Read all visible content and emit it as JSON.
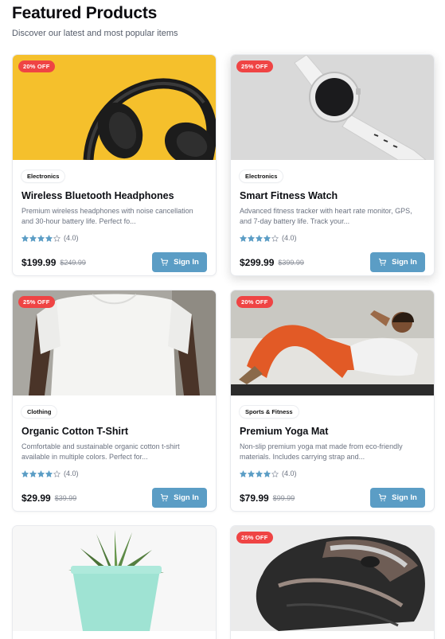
{
  "header": {
    "title": "Featured Products",
    "subtitle": "Discover our latest and most popular items"
  },
  "colors": {
    "accent": "#5b9dc5",
    "discount": "#ef4444",
    "star": "#5b9dc5"
  },
  "products": [
    {
      "discount": "20% OFF",
      "category": "Electronics",
      "name": "Wireless Bluetooth Headphones",
      "description": "Premium wireless headphones with noise cancellation and 30-hour battery life. Perfect fo...",
      "rating": 4.0,
      "rating_label": "(4.0)",
      "price": "$199.99",
      "old_price": "$249.99",
      "button_label": "Sign In",
      "image_icon": "headphones-image"
    },
    {
      "discount": "25% OFF",
      "category": "Electronics",
      "name": "Smart Fitness Watch",
      "description": "Advanced fitness tracker with heart rate monitor, GPS, and 7-day battery life. Track your...",
      "rating": 4.0,
      "rating_label": "(4.0)",
      "price": "$299.99",
      "old_price": "$399.99",
      "button_label": "Sign In",
      "image_icon": "smartwatch-image"
    },
    {
      "discount": "25% OFF",
      "category": "Clothing",
      "name": "Organic Cotton T-Shirt",
      "description": "Comfortable and sustainable organic cotton t-shirt available in multiple colors. Perfect for...",
      "rating": 4.0,
      "rating_label": "(4.0)",
      "price": "$29.99",
      "old_price": "$39.99",
      "button_label": "Sign In",
      "image_icon": "tshirt-image"
    },
    {
      "discount": "20% OFF",
      "category": "Sports & Fitness",
      "name": "Premium Yoga Mat",
      "description": "Non-slip premium yoga mat made from eco-friendly materials. Includes carrying strap and...",
      "rating": 4.0,
      "rating_label": "(4.0)",
      "price": "$79.99",
      "old_price": "$99.99",
      "button_label": "Sign In",
      "image_icon": "yoga-image"
    },
    {
      "discount": "",
      "image_icon": "plant-image"
    },
    {
      "discount": "25% OFF",
      "image_icon": "mouse-image"
    }
  ]
}
